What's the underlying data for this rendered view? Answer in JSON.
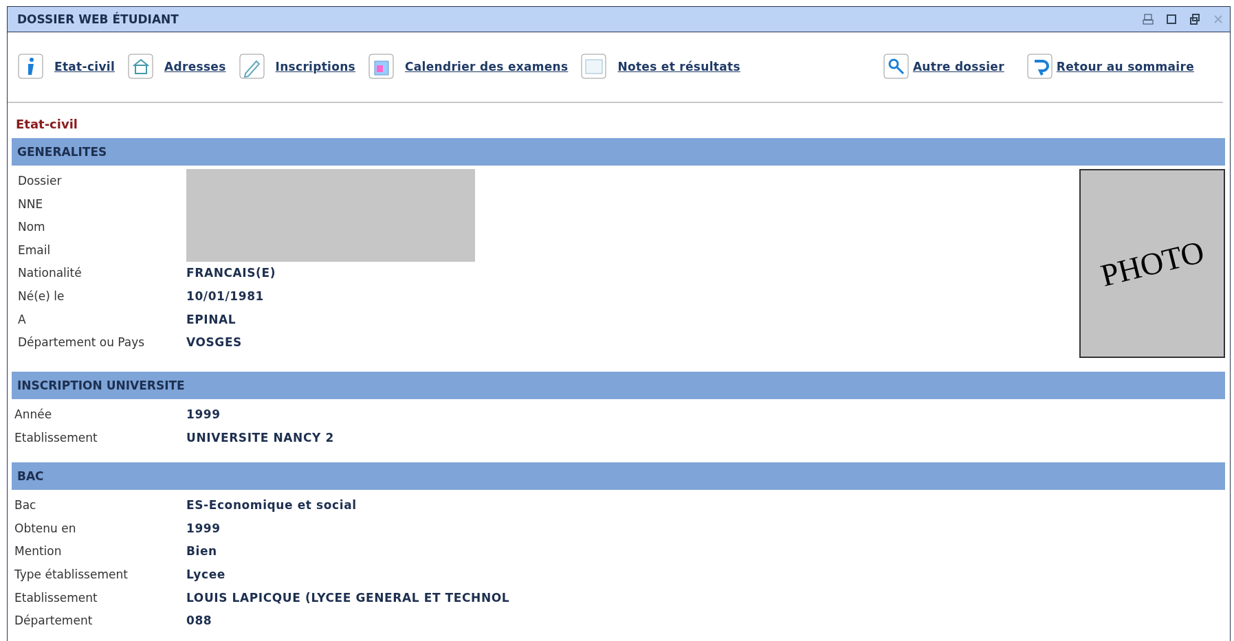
{
  "window": {
    "title": "DOSSIER WEB ÉTUDIANT",
    "controls": [
      {
        "kind": "print",
        "disabled": false
      },
      {
        "kind": "maximize",
        "disabled": false
      },
      {
        "kind": "restore",
        "disabled": false
      },
      {
        "kind": "close",
        "disabled": true
      }
    ]
  },
  "nav": [
    {
      "kind": "info",
      "label": "Etat-civil"
    },
    {
      "kind": "house",
      "label": "Adresses"
    },
    {
      "kind": "pen",
      "label": "Inscriptions"
    },
    {
      "kind": "calendar",
      "label": "Calendrier des examens"
    },
    {
      "kind": "folder",
      "label": "Notes et résultats"
    },
    {
      "kind": "spacer"
    },
    {
      "kind": "search",
      "label": "Autre dossier"
    },
    {
      "kind": "back",
      "label": "Retour au sommaire"
    }
  ],
  "page_heading": "Etat-civil",
  "sections": [
    {
      "title": "GENERALITES",
      "photo": {
        "label": "PHOTO"
      },
      "rows": [
        {
          "label": "Dossier",
          "redacted": true
        },
        {
          "label": "NNE",
          "redacted": true
        },
        {
          "label": "Nom",
          "redacted": true
        },
        {
          "label": "Email",
          "redacted": true
        },
        {
          "label": "Nationalité",
          "value": "FRANCAIS(E)"
        },
        {
          "label": "Né(e) le",
          "value": "10/01/1981"
        },
        {
          "label": "A",
          "value": "EPINAL"
        },
        {
          "label": "Département ou Pays",
          "value": "VOSGES"
        }
      ]
    },
    {
      "title": "INSCRIPTION UNIVERSITE",
      "rows": [
        {
          "label": "Année",
          "value": "1999"
        },
        {
          "label": "Etablissement",
          "value": "UNIVERSITE NANCY 2"
        }
      ]
    },
    {
      "title": "BAC",
      "rows": [
        {
          "label": "Bac",
          "value": "ES-Economique et social"
        },
        {
          "label": "Obtenu en",
          "value": "1999"
        },
        {
          "label": "Mention",
          "value": "Bien"
        },
        {
          "label": "Type établissement",
          "value": "Lycee"
        },
        {
          "label": "Etablissement",
          "value": "LOUIS LAPICQUE (LYCEE GENERAL ET TECHNOL"
        },
        {
          "label": "Département",
          "value": "088"
        }
      ]
    }
  ]
}
